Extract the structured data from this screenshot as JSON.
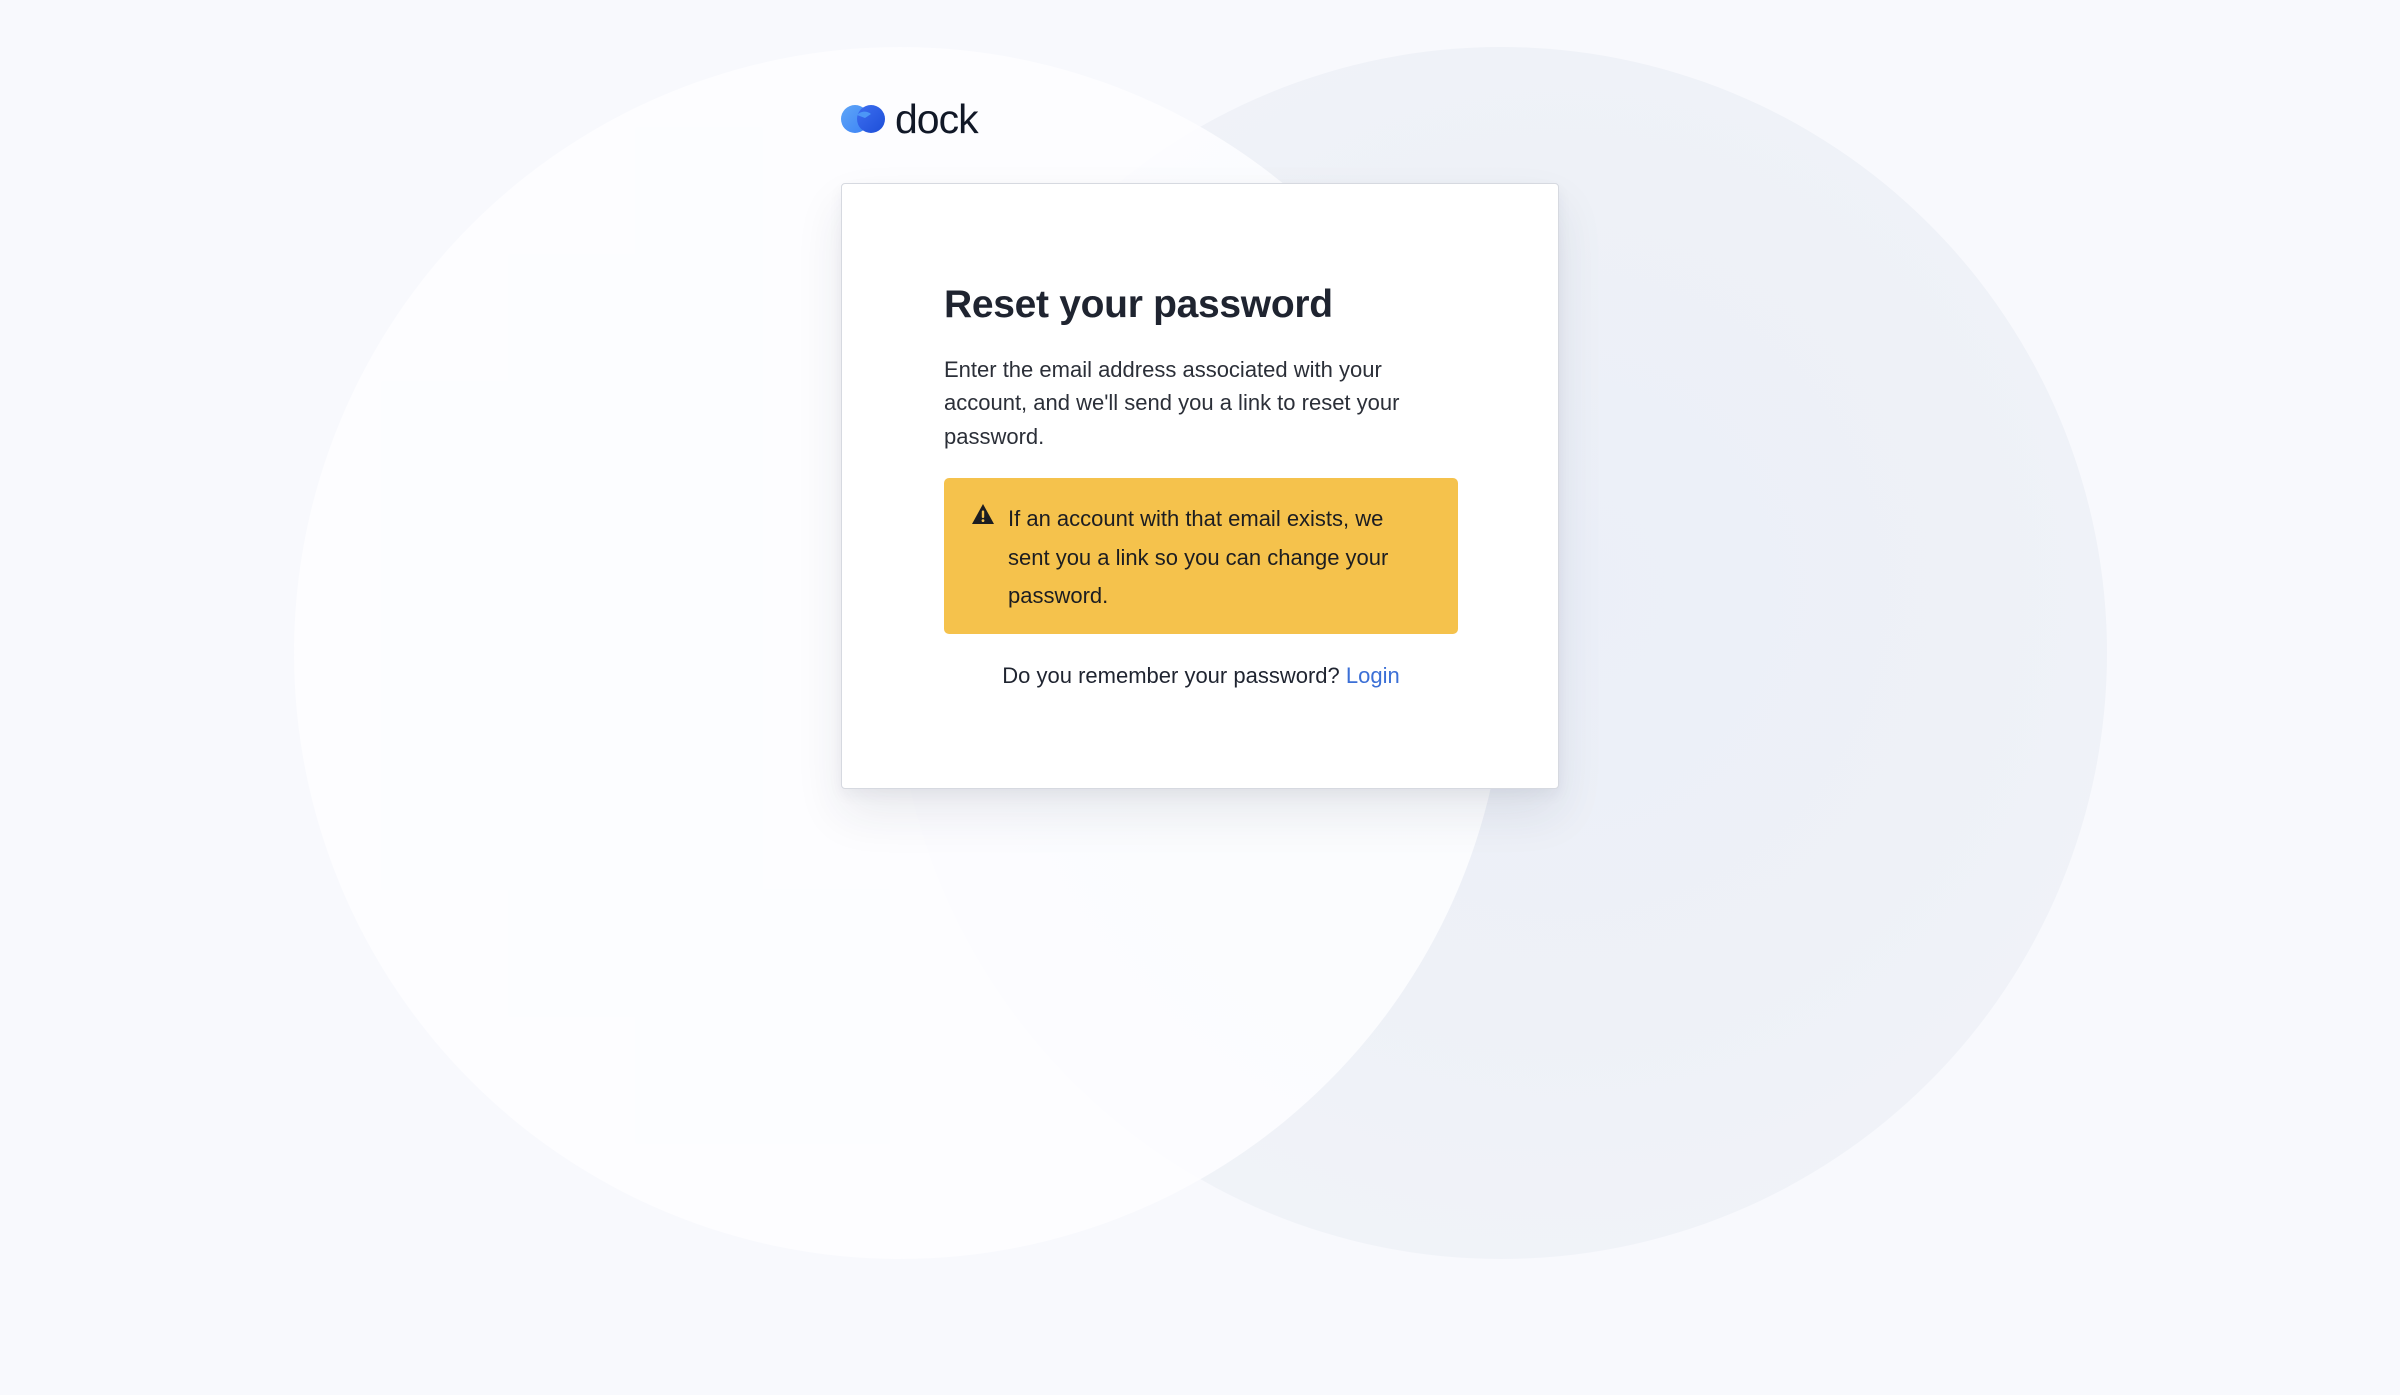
{
  "brand": {
    "name": "dock",
    "logo_icon": "dock-logo-icon",
    "primary_color": "#3b82f6"
  },
  "reset": {
    "title": "Reset your password",
    "description": "Enter the email address associated with your account, and we'll send you a link to reset your password.",
    "alert": {
      "icon": "warning-triangle-icon",
      "text": "If an account with that email exists, we sent you a link so you can change your password.",
      "background_color": "#f5c24c"
    },
    "remember_prompt": "Do you remember your password?",
    "login_link": "Login",
    "link_color": "#3b6fd6"
  }
}
